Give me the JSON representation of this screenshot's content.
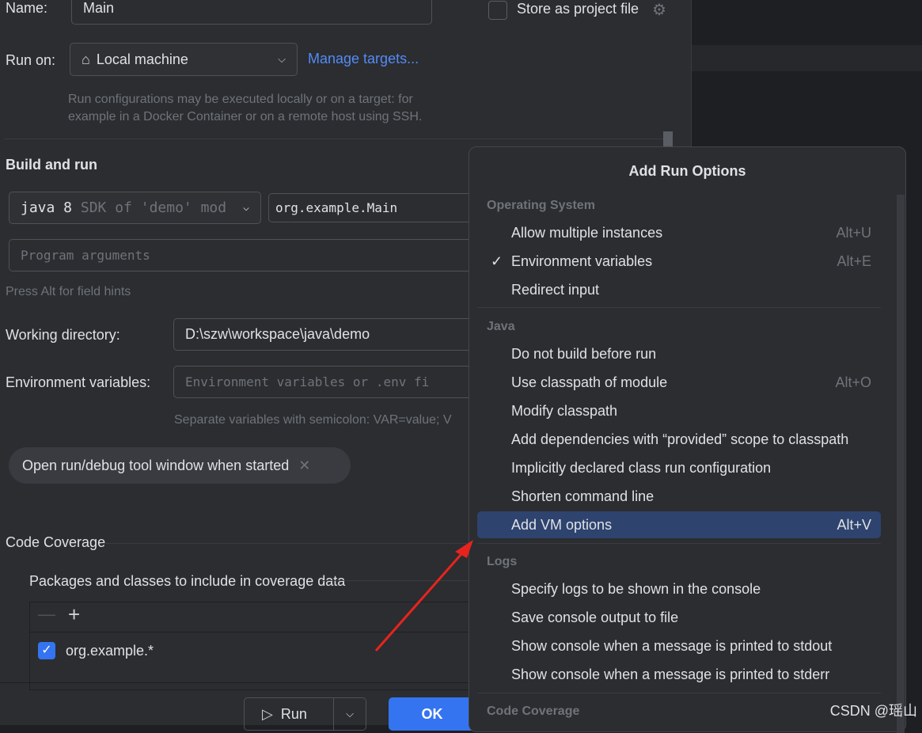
{
  "name": {
    "label": "Name:",
    "value": "Main"
  },
  "store": {
    "label": "Store as project file"
  },
  "run_on": {
    "label": "Run on:",
    "value": "Local machine",
    "link": "Manage targets...",
    "hint1": "Run configurations may be executed locally or on a target: for",
    "hint2": "example in a Docker Container or on a remote host using SSH."
  },
  "build": {
    "title": "Build and run",
    "jdk_main": "java 8",
    "jdk_sub": "SDK of 'demo' mod",
    "main_class": "org.example.Main",
    "program_args_placeholder": "Program arguments",
    "alt_hint": "Press Alt for field hints"
  },
  "workdir": {
    "label": "Working directory:",
    "value": "D:\\szw\\workspace\\java\\demo"
  },
  "env": {
    "label": "Environment variables:",
    "placeholder": "Environment variables or .env fi",
    "hint": "Separate variables with semicolon: VAR=value; V"
  },
  "chip": {
    "label": "Open run/debug tool window when started"
  },
  "coverage": {
    "title": "Code Coverage",
    "packages_title": "Packages and classes to include in coverage data",
    "entry": "org.example.*"
  },
  "buttons": {
    "run": "Run",
    "ok": "OK"
  },
  "popup": {
    "title": "Add Run Options",
    "sections": [
      {
        "name": "Operating System",
        "items": [
          {
            "label": "Allow multiple instances",
            "shortcut": "Alt+U"
          },
          {
            "label": "Environment variables",
            "shortcut": "Alt+E",
            "checked": true
          },
          {
            "label": "Redirect input",
            "shortcut": ""
          }
        ]
      },
      {
        "name": "Java",
        "items": [
          {
            "label": "Do not build before run",
            "shortcut": ""
          },
          {
            "label": "Use classpath of module",
            "shortcut": "Alt+O"
          },
          {
            "label": "Modify classpath",
            "shortcut": ""
          },
          {
            "label": "Add dependencies with “provided” scope to classpath",
            "shortcut": ""
          },
          {
            "label": "Implicitly declared class run configuration",
            "shortcut": ""
          },
          {
            "label": "Shorten command line",
            "shortcut": ""
          },
          {
            "label": "Add VM options",
            "shortcut": "Alt+V",
            "selected": true
          }
        ]
      },
      {
        "name": "Logs",
        "items": [
          {
            "label": "Specify logs to be shown in the console",
            "shortcut": ""
          },
          {
            "label": "Save console output to file",
            "shortcut": ""
          },
          {
            "label": "Show console when a message is printed to stdout",
            "shortcut": ""
          },
          {
            "label": "Show console when a message is printed to stderr",
            "shortcut": ""
          }
        ]
      },
      {
        "name": "Code Coverage",
        "items": []
      }
    ]
  },
  "watermark": "CSDN @瑶山",
  "colors": {
    "accent": "#3574f0",
    "selection": "#2e436e",
    "arrow": "#e8231e"
  }
}
